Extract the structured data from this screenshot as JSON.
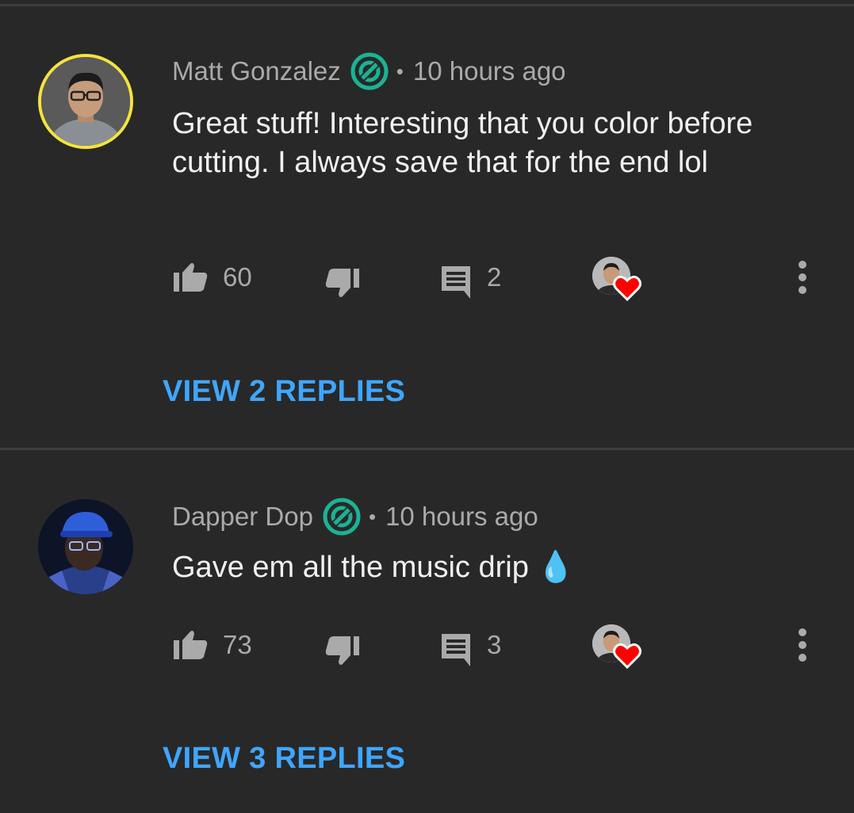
{
  "comments": [
    {
      "author": "Matt Gonzalez",
      "separator": "•",
      "time": "10 hours ago",
      "text": "Great stuff! Interesting that you color before cutting. I always save that for the end lol",
      "likes": "60",
      "replies_count": "2",
      "view_replies_label": "VIEW 2 REPLIES",
      "avatar_ring_color": "#f4e43c"
    },
    {
      "author": "Dapper Dop",
      "separator": "•",
      "time": "10 hours ago",
      "text": "Gave em all the music drip 💧",
      "likes": "73",
      "replies_count": "3",
      "view_replies_label": "VIEW 3 REPLIES"
    }
  ],
  "icons": {
    "badge": "member-badge-icon",
    "like": "thumbs-up-icon",
    "dislike": "thumbs-down-icon",
    "reply": "comment-icon",
    "hearted": "creator-heart-icon",
    "more": "more-vertical-icon"
  },
  "colors": {
    "background": "#282828",
    "link": "#3ea6ff",
    "badge": "#1ab394",
    "heart": "#ff0000",
    "muted_text": "#aaaaaa",
    "body_text": "#f1f1f1"
  }
}
